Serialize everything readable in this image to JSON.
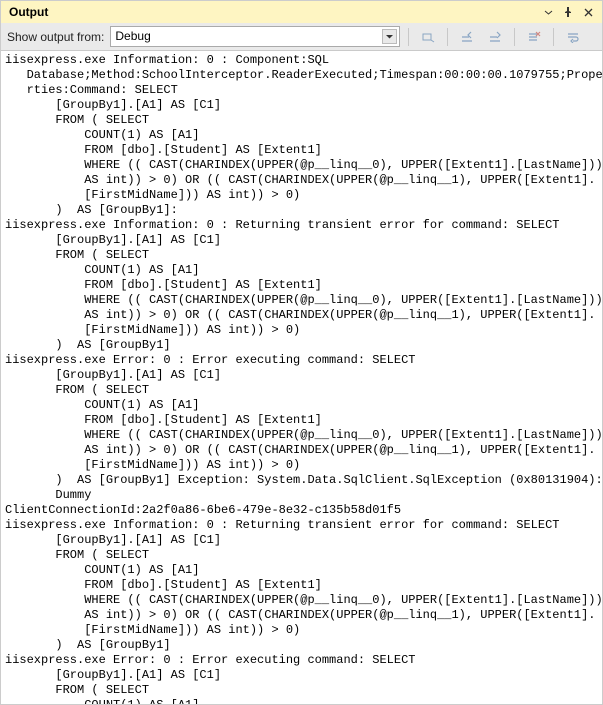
{
  "window": {
    "title": "Output"
  },
  "toolbar": {
    "show_from_label": "Show output from:",
    "source_selected": "Debug"
  },
  "log": [
    "iisexpress.exe Information: 0 : Component:SQL ",
    "   Database;Method:SchoolInterceptor.ReaderExecuted;Timespan:00:00:00.1079755;Prope",
    "   rties:Command: SELECT ",
    "       [GroupBy1].[A1] AS [C1]",
    "       FROM ( SELECT ",
    "           COUNT(1) AS [A1]",
    "           FROM [dbo].[Student] AS [Extent1]",
    "           WHERE (( CAST(CHARINDEX(UPPER(@p__linq__0), UPPER([Extent1].[LastName])) ",
    "           AS int)) > 0) OR (( CAST(CHARINDEX(UPPER(@p__linq__1), UPPER([Extent1].",
    "           [FirstMidName])) AS int)) > 0)",
    "       )  AS [GroupBy1]:",
    "iisexpress.exe Information: 0 : Returning transient error for command: SELECT ",
    "       [GroupBy1].[A1] AS [C1]",
    "       FROM ( SELECT ",
    "           COUNT(1) AS [A1]",
    "           FROM [dbo].[Student] AS [Extent1]",
    "           WHERE (( CAST(CHARINDEX(UPPER(@p__linq__0), UPPER([Extent1].[LastName])) ",
    "           AS int)) > 0) OR (( CAST(CHARINDEX(UPPER(@p__linq__1), UPPER([Extent1].",
    "           [FirstMidName])) AS int)) > 0)",
    "       )  AS [GroupBy1]",
    "iisexpress.exe Error: 0 : Error executing command: SELECT ",
    "       [GroupBy1].[A1] AS [C1]",
    "       FROM ( SELECT ",
    "           COUNT(1) AS [A1]",
    "           FROM [dbo].[Student] AS [Extent1]",
    "           WHERE (( CAST(CHARINDEX(UPPER(@p__linq__0), UPPER([Extent1].[LastName])) ",
    "           AS int)) > 0) OR (( CAST(CHARINDEX(UPPER(@p__linq__1), UPPER([Extent1].",
    "           [FirstMidName])) AS int)) > 0)",
    "       )  AS [GroupBy1] Exception: System.Data.SqlClient.SqlException (0x80131904): ",
    "       Dummy",
    "ClientConnectionId:2a2f0a86-6be6-479e-8e32-c135b58d01f5",
    "iisexpress.exe Information: 0 : Returning transient error for command: SELECT ",
    "       [GroupBy1].[A1] AS [C1]",
    "       FROM ( SELECT ",
    "           COUNT(1) AS [A1]",
    "           FROM [dbo].[Student] AS [Extent1]",
    "           WHERE (( CAST(CHARINDEX(UPPER(@p__linq__0), UPPER([Extent1].[LastName])) ",
    "           AS int)) > 0) OR (( CAST(CHARINDEX(UPPER(@p__linq__1), UPPER([Extent1].",
    "           [FirstMidName])) AS int)) > 0)",
    "       )  AS [GroupBy1]",
    "iisexpress.exe Error: 0 : Error executing command: SELECT ",
    "       [GroupBy1].[A1] AS [C1]",
    "       FROM ( SELECT ",
    "           COUNT(1) AS [A1]"
  ]
}
